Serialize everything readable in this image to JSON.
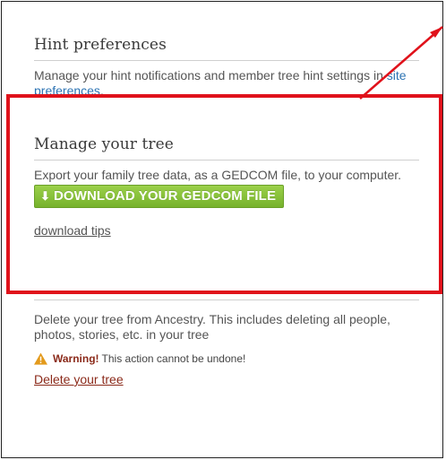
{
  "hint_preferences": {
    "title": "Hint preferences",
    "description": "Manage your hint notifications and member tree hint settings in",
    "link_text": "site preferences",
    "link_suffix": "."
  },
  "manage_tree": {
    "title": "Manage your tree",
    "description": "Export your family tree data, as a GEDCOM file, to your computer.",
    "download_button": "DOWNLOAD YOUR GEDCOM FILE",
    "download_tips": "download tips"
  },
  "delete_tree": {
    "description": "Delete your tree from Ancestry. This includes deleting all people, photos, stories, etc. in your tree",
    "warning_label": "Warning!",
    "warning_text": "This action cannot be undone!",
    "delete_link": "Delete your tree"
  },
  "colors": {
    "highlight": "#e0121b",
    "button": "#84bf36",
    "link": "#2c73b3",
    "danger": "#8b2a1a"
  }
}
